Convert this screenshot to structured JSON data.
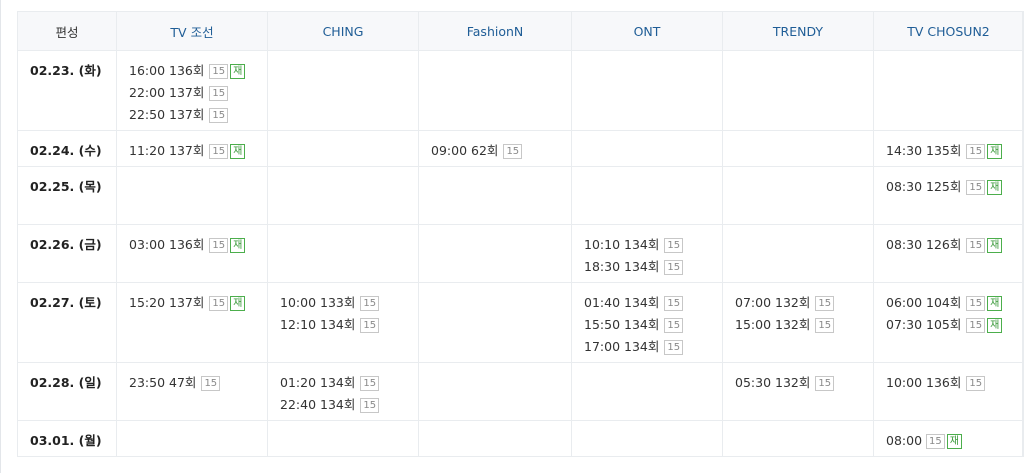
{
  "columns": [
    "편성",
    "TV 조선",
    "CHING",
    "FashionN",
    "ONT",
    "TRENDY",
    "TV CHOSUN2"
  ],
  "rows": [
    {
      "date": "02.23. (화)",
      "cells": [
        [
          {
            "time": "16:00",
            "ep": "136회",
            "rating": "15",
            "re": "재"
          },
          {
            "time": "22:00",
            "ep": "137회",
            "rating": "15",
            "re": ""
          },
          {
            "time": "22:50",
            "ep": "137회",
            "rating": "15",
            "re": ""
          }
        ],
        [],
        [],
        [],
        [],
        []
      ]
    },
    {
      "date": "02.24. (수)",
      "cells": [
        [
          {
            "time": "11:20",
            "ep": "137회",
            "rating": "15",
            "re": "재"
          }
        ],
        [],
        [
          {
            "time": "09:00",
            "ep": "62회",
            "rating": "15",
            "re": ""
          }
        ],
        [],
        [],
        [
          {
            "time": "14:30",
            "ep": "135회",
            "rating": "15",
            "re": "재"
          }
        ]
      ]
    },
    {
      "date": "02.25. (목)",
      "cells": [
        [],
        [],
        [],
        [],
        [],
        [
          {
            "time": "08:30",
            "ep": "125회",
            "rating": "15",
            "re": "재"
          }
        ]
      ]
    },
    {
      "date": "02.26. (금)",
      "cells": [
        [
          {
            "time": "03:00",
            "ep": "136회",
            "rating": "15",
            "re": "재"
          }
        ],
        [],
        [],
        [
          {
            "time": "10:10",
            "ep": "134회",
            "rating": "15",
            "re": ""
          },
          {
            "time": "18:30",
            "ep": "134회",
            "rating": "15",
            "re": ""
          }
        ],
        [],
        [
          {
            "time": "08:30",
            "ep": "126회",
            "rating": "15",
            "re": "재"
          }
        ]
      ]
    },
    {
      "date": "02.27. (토)",
      "cells": [
        [
          {
            "time": "15:20",
            "ep": "137회",
            "rating": "15",
            "re": "재"
          }
        ],
        [
          {
            "time": "10:00",
            "ep": "133회",
            "rating": "15",
            "re": ""
          },
          {
            "time": "12:10",
            "ep": "134회",
            "rating": "15",
            "re": ""
          }
        ],
        [],
        [
          {
            "time": "01:40",
            "ep": "134회",
            "rating": "15",
            "re": ""
          },
          {
            "time": "15:50",
            "ep": "134회",
            "rating": "15",
            "re": ""
          },
          {
            "time": "17:00",
            "ep": "134회",
            "rating": "15",
            "re": ""
          }
        ],
        [
          {
            "time": "07:00",
            "ep": "132회",
            "rating": "15",
            "re": ""
          },
          {
            "time": "15:00",
            "ep": "132회",
            "rating": "15",
            "re": ""
          }
        ],
        [
          {
            "time": "06:00",
            "ep": "104회",
            "rating": "15",
            "re": "재"
          },
          {
            "time": "07:30",
            "ep": "105회",
            "rating": "15",
            "re": "재"
          }
        ]
      ]
    },
    {
      "date": "02.28. (일)",
      "cells": [
        [
          {
            "time": "23:50",
            "ep": "47회",
            "rating": "15",
            "re": ""
          }
        ],
        [
          {
            "time": "01:20",
            "ep": "134회",
            "rating": "15",
            "re": ""
          },
          {
            "time": "22:40",
            "ep": "134회",
            "rating": "15",
            "re": ""
          }
        ],
        [],
        [],
        [
          {
            "time": "05:30",
            "ep": "132회",
            "rating": "15",
            "re": ""
          }
        ],
        [
          {
            "time": "10:00",
            "ep": "136회",
            "rating": "15",
            "re": ""
          }
        ]
      ]
    },
    {
      "date": "03.01. (월)",
      "cells": [
        [],
        [],
        [],
        [],
        [],
        [
          {
            "time": "08:00",
            "ep": "",
            "rating": "15",
            "re": "재"
          }
        ]
      ]
    }
  ]
}
